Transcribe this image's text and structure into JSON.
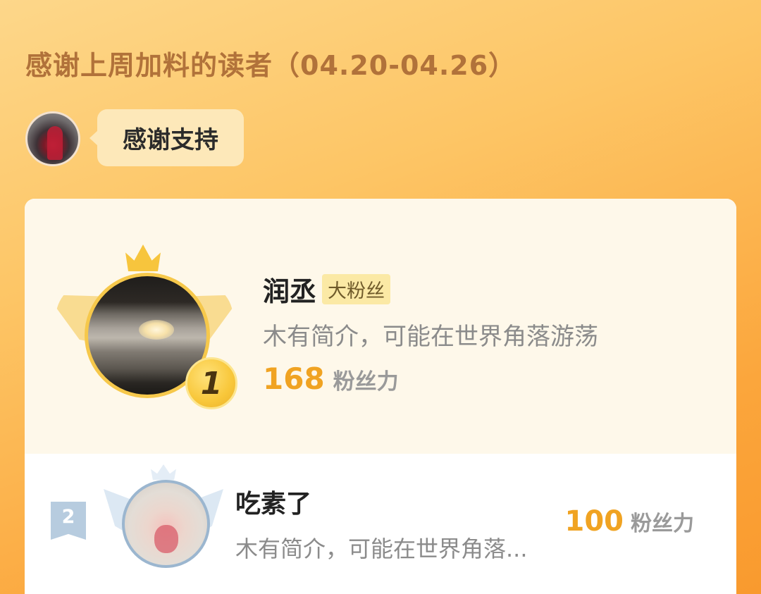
{
  "header": {
    "title": "感谢上周加料的读者（04.20-04.26）"
  },
  "thanks": {
    "message": "感谢支持"
  },
  "leaderboard": {
    "first": {
      "rank": "1",
      "name": "润丞",
      "badge": "大粉丝",
      "intro": "木有简介，可能在世界角落游荡",
      "power_value": "168",
      "power_label": "粉丝力"
    },
    "second": {
      "rank": "2",
      "name": "吃素了",
      "intro": "木有简介，可能在世界角落...",
      "power_value": "100",
      "power_label": "粉丝力"
    }
  },
  "colors": {
    "accent": "#f0a322",
    "title": "#b1723a",
    "badge_bg": "#fbe9a5"
  }
}
